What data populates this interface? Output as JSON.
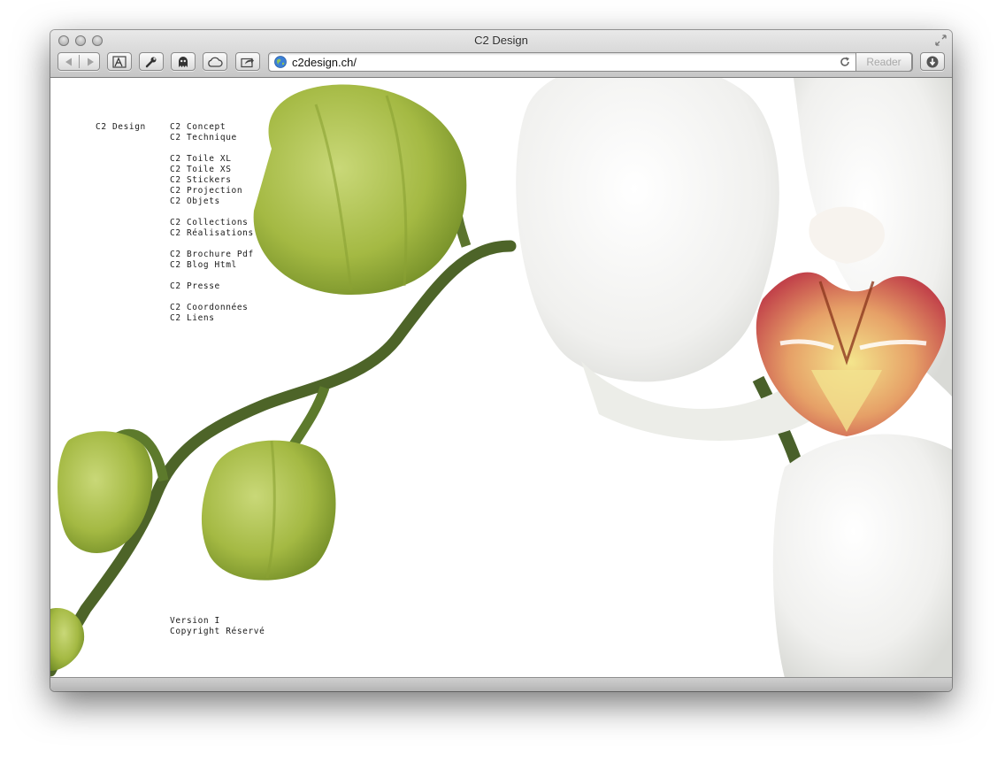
{
  "window": {
    "title": "C2 Design",
    "url": "c2design.ch/",
    "reader_label": "Reader"
  },
  "toolbar": {
    "icons": [
      "back-icon",
      "forward-icon",
      "tower-icon",
      "wrench-icon",
      "ghost-icon",
      "cloud-icon",
      "share-icon",
      "download-icon"
    ]
  },
  "site": {
    "brand": "C2 Design",
    "menu": [
      [
        "C2 Concept",
        "C2 Technique"
      ],
      [
        "C2 Toile XL",
        "C2 Toile XS",
        "C2 Stickers",
        "C2 Projection",
        "C2 Objets"
      ],
      [
        "C2 Collections",
        "C2 Réalisations"
      ],
      [
        "C2 Brochure Pdf",
        "C2 Blog Html"
      ],
      [
        "C2 Presse"
      ],
      [
        "C2 Coordonnées",
        "C2 Liens"
      ]
    ],
    "footer": {
      "version": "Version I",
      "copyright": "Copyright Réservé"
    }
  },
  "colors": {
    "bud_green": "#a9bf45",
    "stem_green": "#4d6428",
    "petal_white": "#f1f1f0",
    "lip_red": "#c0463d",
    "lip_yellow": "#f0dc7a"
  }
}
